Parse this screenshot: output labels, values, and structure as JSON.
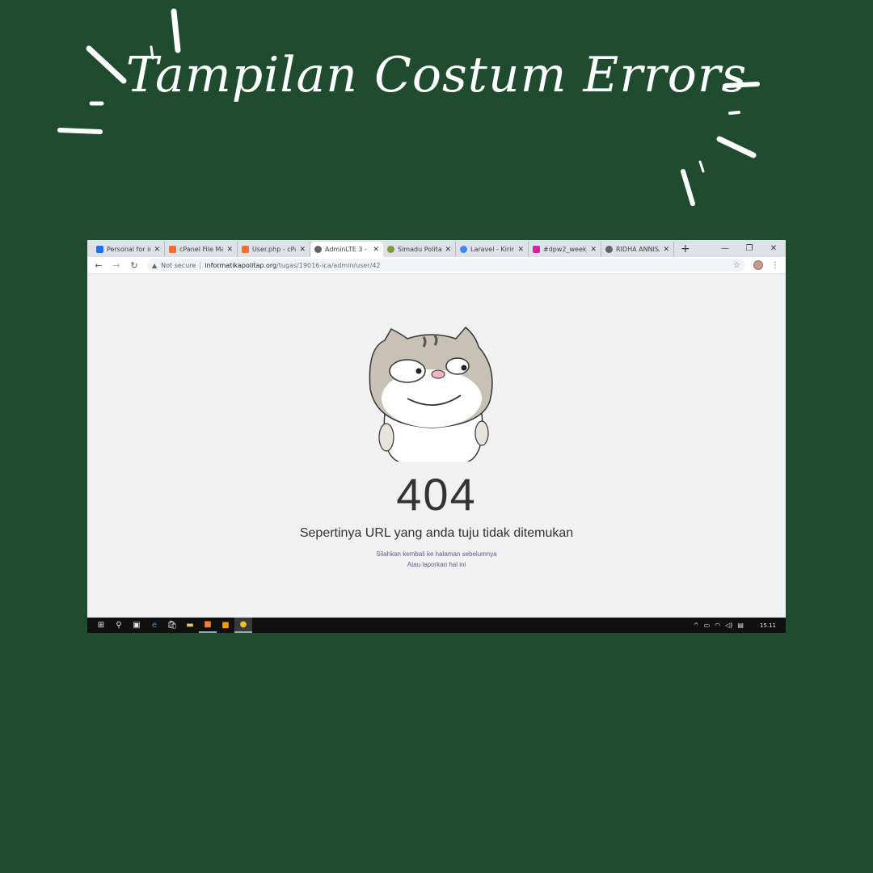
{
  "poster": {
    "title": "Tampilan Costum Errors"
  },
  "browser": {
    "tabs": [
      {
        "label": "Personal for in",
        "favicon_color": "#1a73e8",
        "icon": "personal-site-icon"
      },
      {
        "label": "cPanel File Ma",
        "favicon_color": "#ff6c2c",
        "icon": "cpanel-icon"
      },
      {
        "label": "User.php - cPa",
        "favicon_color": "#ff6c2c",
        "icon": "cpanel-icon"
      },
      {
        "label": "AdminLTE 3 - ",
        "favicon_color": "#5f6368",
        "icon": "globe-icon",
        "active": true
      },
      {
        "label": "Simadu Politap",
        "favicon_color": "#7a9a3a",
        "icon": "simadu-icon"
      },
      {
        "label": "Laravel - Kirim",
        "favicon_color": "#4285f4",
        "icon": "google-c-icon"
      },
      {
        "label": "#dpw2_week_",
        "favicon_color": "#d6249f",
        "icon": "instagram-icon"
      },
      {
        "label": "RIDHA ANNISA",
        "favicon_color": "#5f6368",
        "icon": "globe-icon"
      }
    ],
    "address": {
      "security_label": "Not secure",
      "host": "informatikapolitap.org",
      "path": "/tugas/19016-ica/admin/user/42"
    }
  },
  "page": {
    "code": "404",
    "message": "Sepertinya URL yang anda tuju tidak ditemukan",
    "back_link": "Silahkan kembali ke halaman sebelumnya",
    "report_link": "Atau laporkan hal ini"
  },
  "taskbar": {
    "clock": "15.11",
    "accent": "#9ab0c0"
  },
  "colors": {
    "background": "#1f4b2f",
    "page_bg": "#f1f1f1",
    "link": "#5a5f93"
  }
}
